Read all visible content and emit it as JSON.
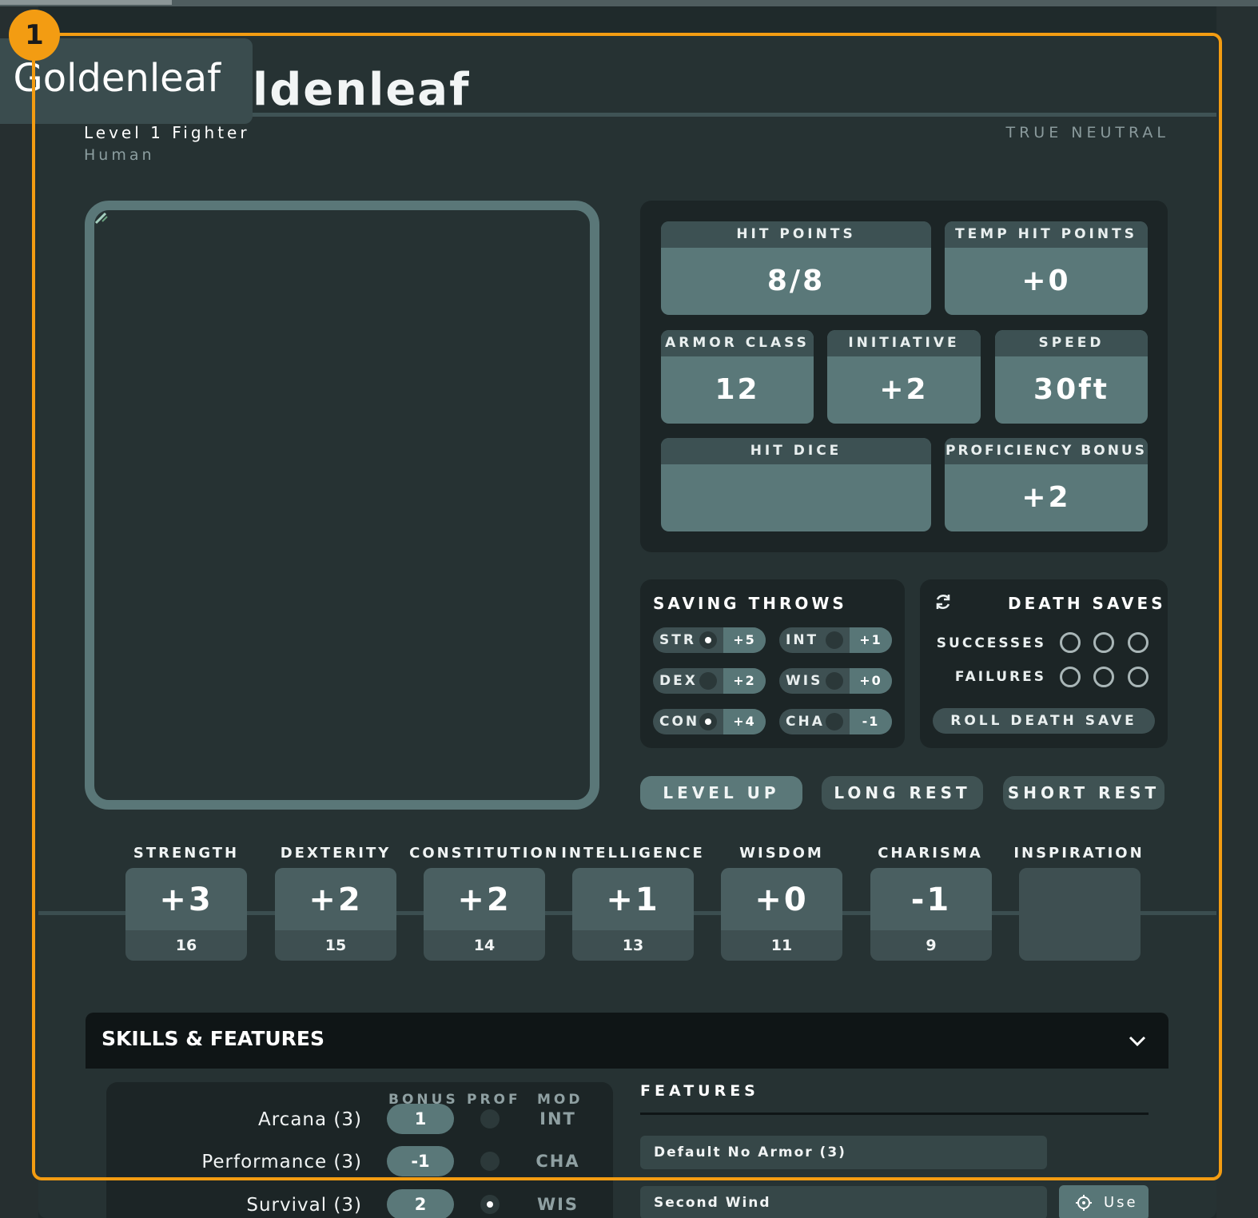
{
  "character": {
    "name_partial": "ldenleaf",
    "level_class": "Level 1 Fighter",
    "race": "Human",
    "alignment": "TRUE NEUTRAL"
  },
  "tooltip": {
    "text": "a Goldenleaf"
  },
  "highlight_badge": "1",
  "stats": {
    "hit_points": {
      "label": "HIT POINTS",
      "value": "8/8"
    },
    "temp_hit_points": {
      "label": "TEMP HIT POINTS",
      "value": "+0"
    },
    "armor_class": {
      "label": "ARMOR CLASS",
      "value": "12"
    },
    "initiative": {
      "label": "INITIATIVE",
      "value": "+2"
    },
    "speed": {
      "label": "SPEED",
      "value": "30ft"
    },
    "hit_dice": {
      "label": "HIT DICE",
      "value": ""
    },
    "proficiency_bonus": {
      "label": "PROFICIENCY BONUS",
      "value": "+2"
    }
  },
  "saving_throws": {
    "title": "SAVING THROWS",
    "items": [
      {
        "ability": "STR",
        "mod": "+5",
        "proficient": true
      },
      {
        "ability": "INT",
        "mod": "+1",
        "proficient": false
      },
      {
        "ability": "DEX",
        "mod": "+2",
        "proficient": false
      },
      {
        "ability": "WIS",
        "mod": "+0",
        "proficient": false
      },
      {
        "ability": "CON",
        "mod": "+4",
        "proficient": true
      },
      {
        "ability": "CHA",
        "mod": "-1",
        "proficient": false
      }
    ]
  },
  "death_saves": {
    "title": "DEATH SAVES",
    "successes_label": "SUCCESSES",
    "failures_label": "FAILURES",
    "successes": 0,
    "failures": 0,
    "roll_label": "ROLL DEATH SAVE"
  },
  "actions": {
    "level_up": "LEVEL UP",
    "long_rest": "LONG REST",
    "short_rest": "SHORT REST"
  },
  "abilities": [
    {
      "name": "STRENGTH",
      "mod": "+3",
      "score": "16"
    },
    {
      "name": "DEXTERITY",
      "mod": "+2",
      "score": "15"
    },
    {
      "name": "CONSTITUTION",
      "mod": "+2",
      "score": "14"
    },
    {
      "name": "INTELLIGENCE",
      "mod": "+1",
      "score": "13"
    },
    {
      "name": "WISDOM",
      "mod": "+0",
      "score": "11"
    },
    {
      "name": "CHARISMA",
      "mod": "-1",
      "score": "9"
    },
    {
      "name": "INSPIRATION",
      "mod": "",
      "score": ""
    }
  ],
  "skills_section": {
    "title": "SKILLS & FEATURES",
    "columns": {
      "bonus": "BONUS",
      "prof": "PROF",
      "mod": "MOD"
    },
    "skills": [
      {
        "name": "Arcana (3)",
        "bonus": "1",
        "proficient": false,
        "mod": "INT"
      },
      {
        "name": "Performance (3)",
        "bonus": "-1",
        "proficient": false,
        "mod": "CHA"
      },
      {
        "name": "Survival (3)",
        "bonus": "2",
        "proficient": true,
        "mod": "WIS"
      }
    ],
    "features_title": "FEATURES",
    "features": [
      {
        "name": "Default No Armor (3)"
      },
      {
        "name": "Second Wind"
      }
    ],
    "use_label": "Use"
  },
  "colors": {
    "highlight": "#f39c12",
    "panel": "#1c2526",
    "accent": "#5a7879"
  }
}
